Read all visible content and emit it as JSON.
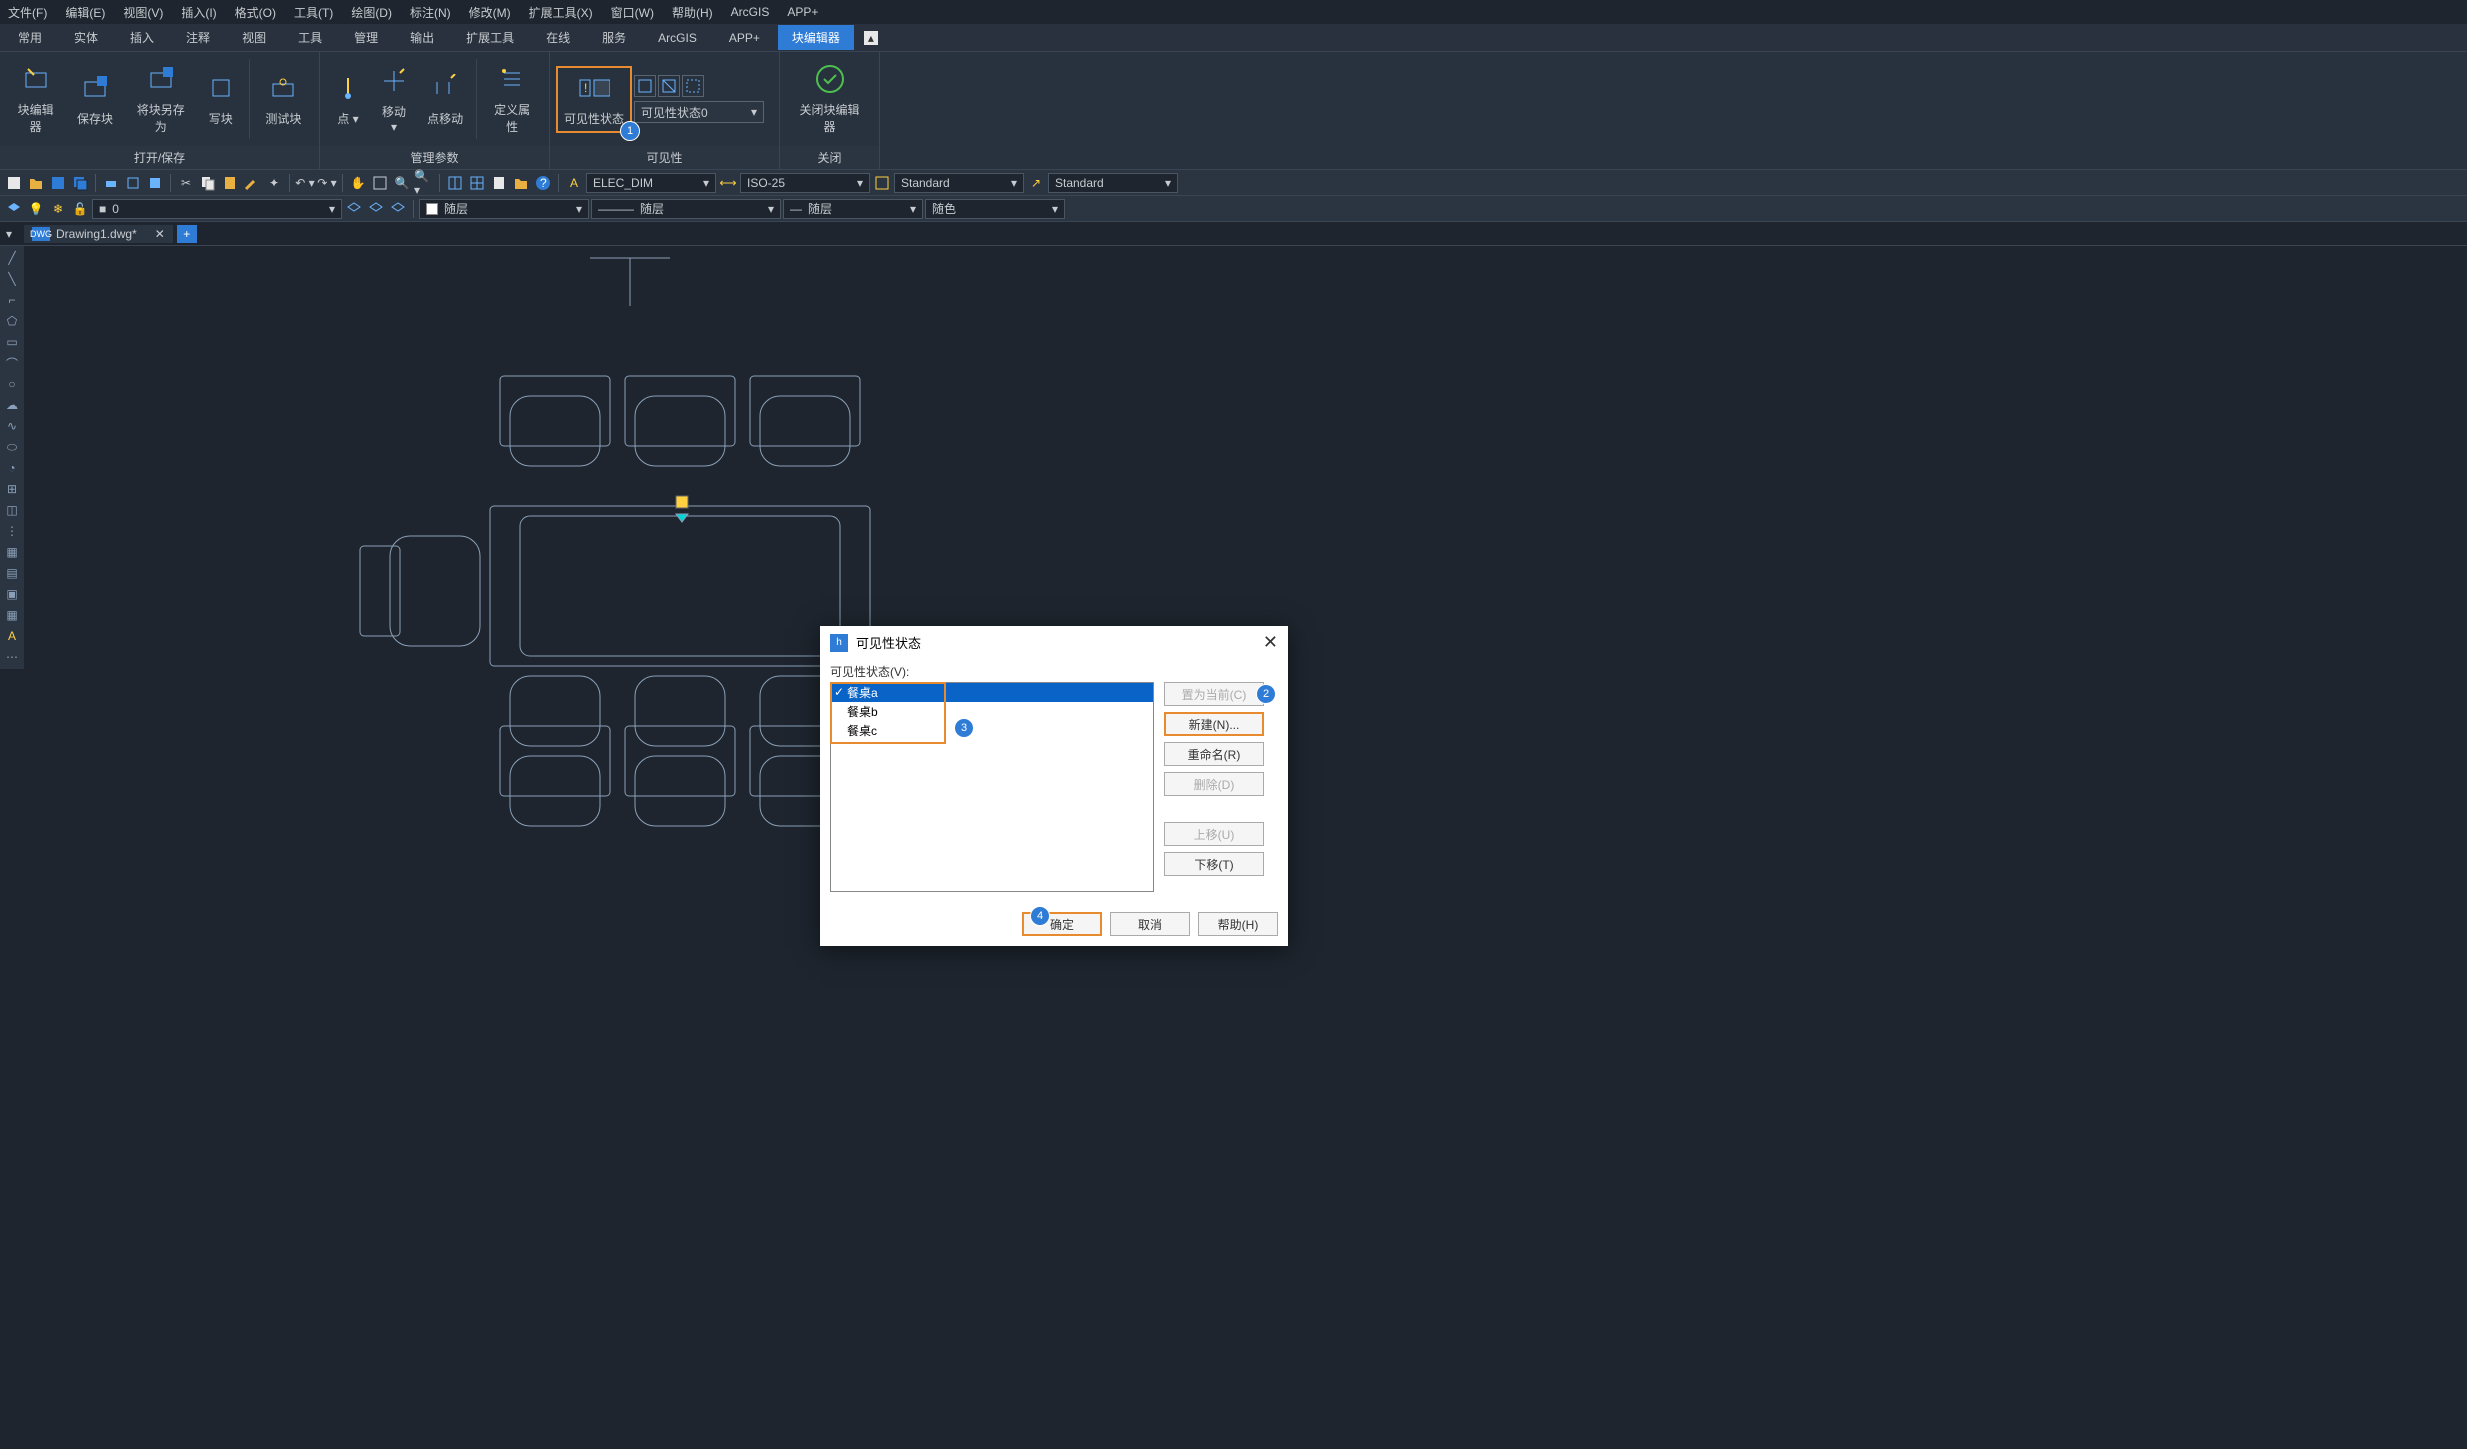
{
  "menubar": [
    "文件(F)",
    "编辑(E)",
    "视图(V)",
    "插入(I)",
    "格式(O)",
    "工具(T)",
    "绘图(D)",
    "标注(N)",
    "修改(M)",
    "扩展工具(X)",
    "窗口(W)",
    "帮助(H)",
    "ArcGIS",
    "APP+"
  ],
  "ribbon_tabs": [
    "常用",
    "实体",
    "插入",
    "注释",
    "视图",
    "工具",
    "管理",
    "输出",
    "扩展工具",
    "在线",
    "服务",
    "ArcGIS",
    "APP+",
    "块编辑器"
  ],
  "ribbon_active_tab": "块编辑器",
  "ribbon": {
    "group1": {
      "label": "打开/保存",
      "btns": [
        "块编辑器",
        "保存块",
        "将块另存为",
        "写块",
        "测试块"
      ]
    },
    "group2": {
      "label": "管理参数",
      "btns": [
        "点",
        "移动",
        "点移动",
        "定义属性"
      ]
    },
    "group3": {
      "label": "可见性",
      "btn": "可见性状态",
      "dropdown": "可见性状态0"
    },
    "group4": {
      "label": "关闭",
      "btn": "关闭块编辑器"
    }
  },
  "toolbar_dropdowns": {
    "dim": "ELEC_DIM",
    "iso": "ISO-25",
    "std1": "Standard",
    "std2": "Standard"
  },
  "props_row": {
    "layer0": "0",
    "linetype1": "随层",
    "linetype2": "随层",
    "linetype3": "随层",
    "color": "随色"
  },
  "doc_tab": "Drawing1.dwg*",
  "dialog": {
    "title": "可见性状态",
    "label": "可见性状态(V):",
    "items": [
      "餐桌a",
      "餐桌b",
      "餐桌c"
    ],
    "selected": 0,
    "buttons": {
      "set_current": "置为当前(C)",
      "new": "新建(N)...",
      "rename": "重命名(R)",
      "delete": "删除(D)",
      "up": "上移(U)",
      "down": "下移(T)",
      "ok": "确定",
      "cancel": "取消",
      "help": "帮助(H)"
    }
  },
  "badges": {
    "b1": "1",
    "b2": "2",
    "b3": "3",
    "b4": "4"
  }
}
